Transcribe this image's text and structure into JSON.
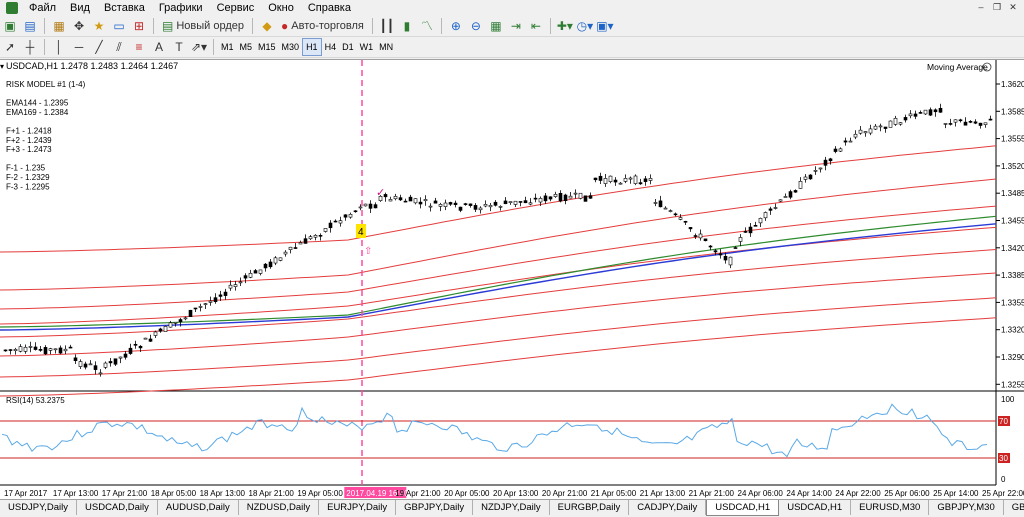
{
  "menu": [
    "Файл",
    "Вид",
    "Вставка",
    "Графики",
    "Сервис",
    "Окно",
    "Справка"
  ],
  "toolbar": {
    "new_order": "Новый ордер",
    "auto_trading": "Авто-торговля"
  },
  "timeframes": [
    "M1",
    "M5",
    "M15",
    "M30",
    "H1",
    "H4",
    "D1",
    "W1",
    "MN"
  ],
  "active_timeframe": "H1",
  "chart": {
    "symbol_line": "USDCAD,H1  1.2478 1.2483 1.2464 1.2467",
    "indicator_name": "Moving Average",
    "info_lines": [
      "RISK MODEL #1 (1-4)",
      "",
      "EMA144 - 1.2395",
      "EMA169 - 1.2384",
      "",
      "F+1 - 1.2418",
      "F+2 - 1.2439",
      "F+3 - 1.2473",
      "",
      "F-1 - 1.235",
      "F-2 - 1.2329",
      "F-3 - 1.2295"
    ],
    "price_ticks": [
      "1.3620",
      "1.3585",
      "1.3555",
      "1.3520",
      "1.3485",
      "1.3455",
      "1.3420",
      "1.3385",
      "1.3355",
      "1.3320",
      "1.3290",
      "1.3255"
    ],
    "rsi_label": "RSI(14) 53.2375",
    "rsi_levels": [
      "70",
      "30"
    ],
    "rsi_top": "100",
    "rsi_bottom": "0",
    "time_ticks": [
      "17 Apr 2017",
      "17 Apr 13:00",
      "17 Apr 21:00",
      "18 Apr 05:00",
      "18 Apr 13:00",
      "18 Apr 21:00",
      "19 Apr 05:00",
      "2017.04.19 16:00",
      "19 Apr 21:00",
      "20 Apr 05:00",
      "20 Apr 13:00",
      "20 Apr 21:00",
      "21 Apr 05:00",
      "21 Apr 13:00",
      "21 Apr 21:00",
      "24 Apr 06:00",
      "24 Apr 14:00",
      "24 Apr 22:00",
      "25 Apr 06:00",
      "25 Apr 14:00",
      "25 Apr 22:00"
    ],
    "highlight_time": "2017.04.19 16:00",
    "marker_label": "4",
    "colors": {
      "ema_blue": "#2b3bd6",
      "ema_green": "#2e8b2e",
      "fib_red": "#e43d3d",
      "rsi_line": "#5aa9e6",
      "rsi_level": "#cc2222",
      "vline": "#ff4aa0",
      "marker_bg": "#ffe400"
    }
  },
  "tabs": [
    "USDJPY,Daily",
    "USDCAD,Daily",
    "AUDUSD,Daily",
    "NZDUSD,Daily",
    "EURJPY,Daily",
    "GBPJPY,Daily",
    "NZDJPY,Daily",
    "EURGBP,Daily",
    "CADJPY,Daily",
    "USDCAD,H1",
    "USDCAD,H1",
    "EURUSD,M30",
    "GBPJPY,M30",
    "GBPUSD,M30"
  ],
  "active_tab_index": 9
}
